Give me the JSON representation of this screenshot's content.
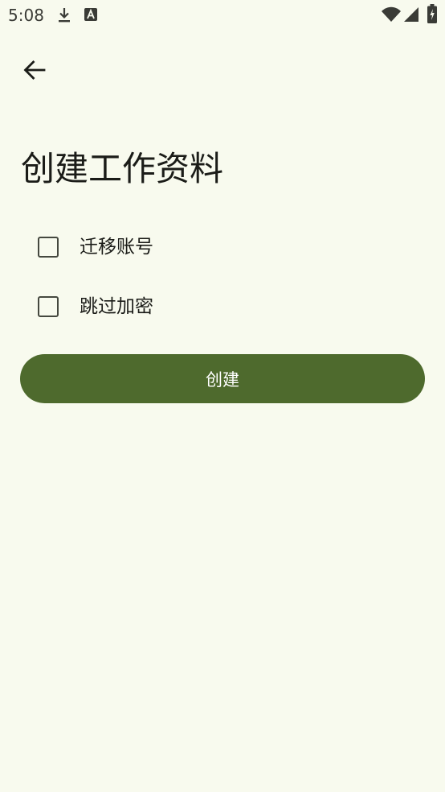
{
  "status_bar": {
    "time": "5:08",
    "icons": [
      "download-icon",
      "font-a-icon",
      "wifi-icon",
      "signal-icon",
      "battery-charging-icon"
    ]
  },
  "header": {
    "back_icon": "arrow-back-icon"
  },
  "page": {
    "title": "创建工作资料"
  },
  "options": [
    {
      "label": "迁移账号",
      "checked": false
    },
    {
      "label": "跳过加密",
      "checked": false
    }
  ],
  "actions": {
    "create_label": "创建"
  },
  "colors": {
    "background": "#f8faee",
    "primary": "#4e6a2d",
    "on_primary": "#ffffff",
    "text": "#1b1c18",
    "checkbox_border": "#45483f"
  }
}
